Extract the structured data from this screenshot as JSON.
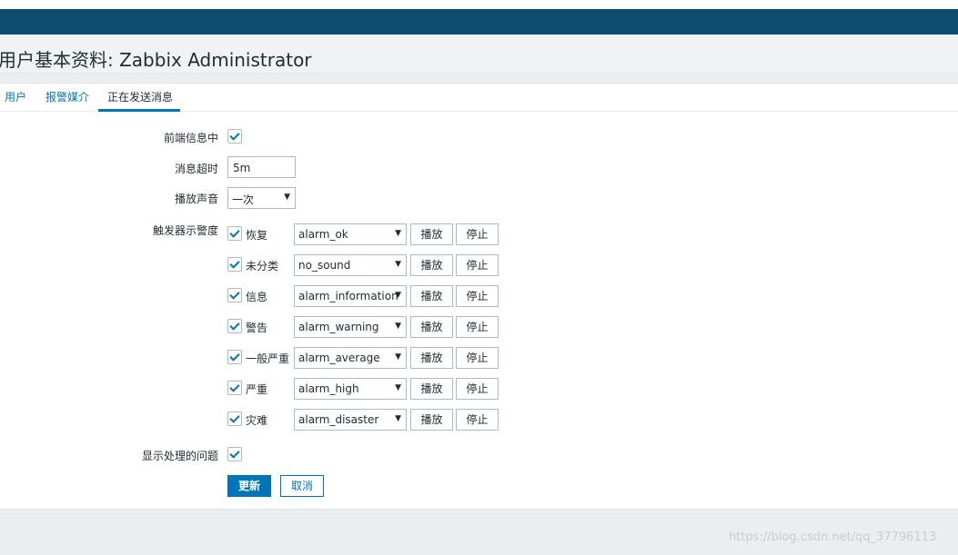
{
  "page": {
    "title": "用户基本资料: Zabbix Administrator"
  },
  "tabs": [
    {
      "label": "用户"
    },
    {
      "label": "报警媒介"
    },
    {
      "label": "正在发送消息"
    }
  ],
  "form": {
    "frontend_messaging_label": "前端信息中",
    "frontend_messaging_checked": true,
    "timeout_label": "消息超时",
    "timeout_value": "5m",
    "play_sound_label": "播放声音",
    "play_sound_value": "一次",
    "trigger_severity_label": "触发器示警度",
    "severities": [
      {
        "label": "恢复",
        "checked": true,
        "sound": "alarm_ok"
      },
      {
        "label": "未分类",
        "checked": true,
        "sound": "no_sound"
      },
      {
        "label": "信息",
        "checked": true,
        "sound": "alarm_information"
      },
      {
        "label": "警告",
        "checked": true,
        "sound": "alarm_warning"
      },
      {
        "label": "一般严重",
        "checked": true,
        "sound": "alarm_average"
      },
      {
        "label": "严重",
        "checked": true,
        "sound": "alarm_high"
      },
      {
        "label": "灾难",
        "checked": true,
        "sound": "alarm_disaster"
      }
    ],
    "play_button_label": "播放",
    "stop_button_label": "停止",
    "show_suppressed_label": "显示处理的问题",
    "show_suppressed_checked": true,
    "update_button_label": "更新",
    "cancel_button_label": "取消"
  },
  "watermark": "https://blog.csdn.net/qq_37796113",
  "colors": {
    "topbar": "#0f4a6f",
    "accent": "#0275b8"
  }
}
